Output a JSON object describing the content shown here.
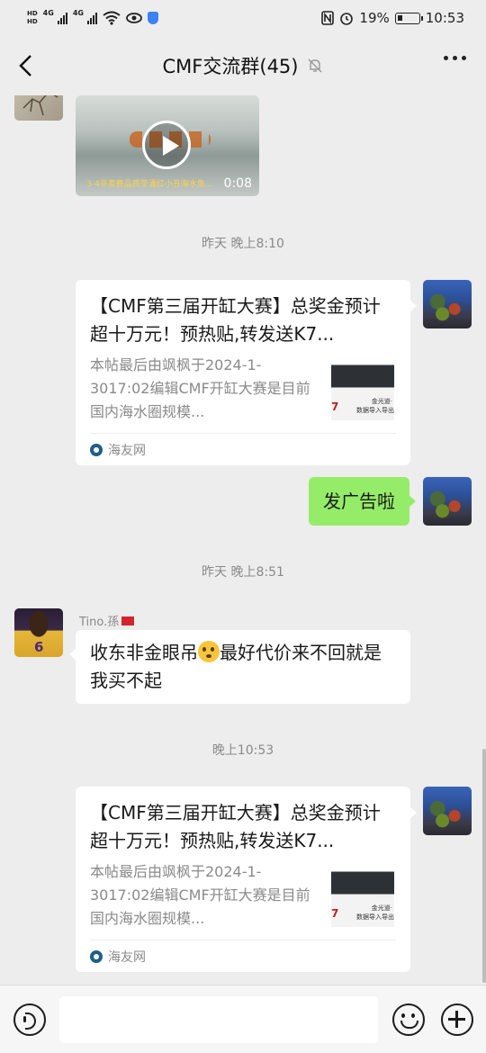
{
  "status_bar": {
    "hd_top": "HD",
    "hd_bottom": "HD",
    "network_1": "4G",
    "network_2": "4G",
    "battery_percent": "19%",
    "time": "10:53",
    "icons": [
      "nfc-icon",
      "alarm-icon",
      "battery-icon",
      "wifi-icon",
      "eye-icon",
      "shield-icon"
    ]
  },
  "header": {
    "title": "CMF交流群(45)",
    "icons": [
      "back-icon",
      "mute-bell-icon",
      "more-icon"
    ]
  },
  "messages": {
    "video": {
      "caption": "3-4非卖赛品质圣涌红小丑海水鱼...",
      "duration": "0:08"
    },
    "time_1": "昨天 晚上8:10",
    "link_card_1": {
      "title": "【CMF第三届开缸大赛】总奖金预计超十万元！预热贴,转发送K7...",
      "description": "本帖最后由飒枫于2024-1-3017:02编辑CMF开缸大赛是目前国内海水圈规模...",
      "source": "海友网",
      "thumb_number": "7",
      "thumb_text_1": "金光道·",
      "thumb_text_2": "数据导入导出"
    },
    "my_text": "发广告啦",
    "time_2": "昨天 晚上8:51",
    "sender_name": "Tino.孫",
    "avatar_number": "6",
    "text_part_1": "收东非金眼吊",
    "text_part_2": "最好代价来不回就是我买不起",
    "time_3": "晚上10:53",
    "link_card_2": {
      "title": "【CMF第三届开缸大赛】总奖金预计超十万元！预热贴,转发送K7...",
      "description": "本帖最后由飒枫于2024-1-3017:02编辑CMF开缸大赛是目前国内海水圈规模...",
      "source": "海友网",
      "thumb_number": "7",
      "thumb_text_1": "金光道·",
      "thumb_text_2": "数据导入导出"
    }
  },
  "input_bar": {
    "text_value": "",
    "icons": [
      "voice-icon",
      "emoji-icon",
      "plus-icon"
    ]
  },
  "colors": {
    "chat_background": "#ededed",
    "my_bubble": "#95ec69",
    "other_bubble": "#ffffff",
    "timestamp_text": "#8a8a8a"
  }
}
